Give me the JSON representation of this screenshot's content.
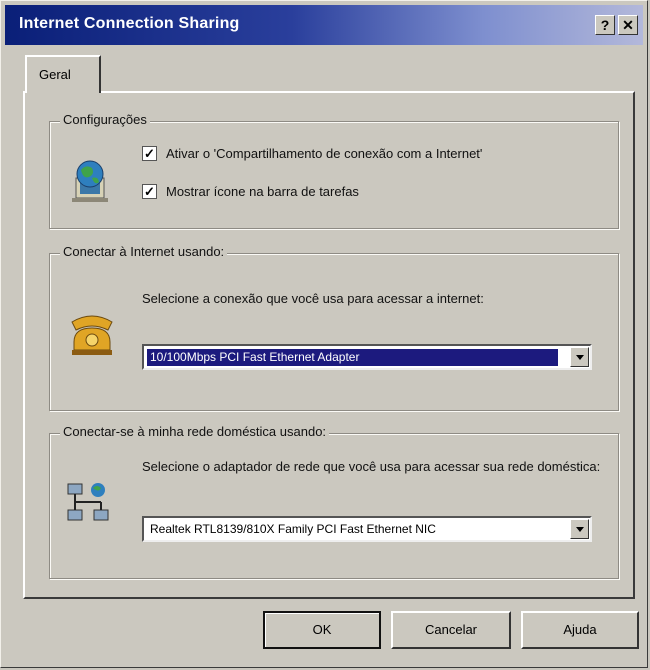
{
  "window": {
    "title": "Internet Connection Sharing",
    "help_label": "?",
    "close_label": "✕"
  },
  "tabs": [
    {
      "label": "Geral"
    }
  ],
  "settings_group": {
    "legend": "Configurações",
    "icon": "globe-network-icon",
    "enable_sharing": {
      "label": "Ativar o 'Compartilhamento de conexão com a Internet'",
      "checked": true
    },
    "show_tray_icon": {
      "label": "Mostrar ícone na barra de tarefas",
      "checked": true
    }
  },
  "internet_group": {
    "legend": "Conectar à Internet usando:",
    "icon": "dialup-phone-icon",
    "description": "Selecione a conexão que você usa para acessar a internet:",
    "selected_value": "10/100Mbps PCI Fast Ethernet Adapter",
    "selected_highlight_color": "#1c1a7e"
  },
  "home_network_group": {
    "legend": "Conectar-se à minha rede doméstica usando:",
    "icon": "home-network-icon",
    "description": "Selecione o adaptador de rede que você usa para acessar sua rede doméstica:",
    "selected_value": "Realtek RTL8139/810X Family PCI Fast Ethernet NIC"
  },
  "buttons": {
    "ok": "OK",
    "cancel": "Cancelar",
    "help": "Ajuda"
  }
}
